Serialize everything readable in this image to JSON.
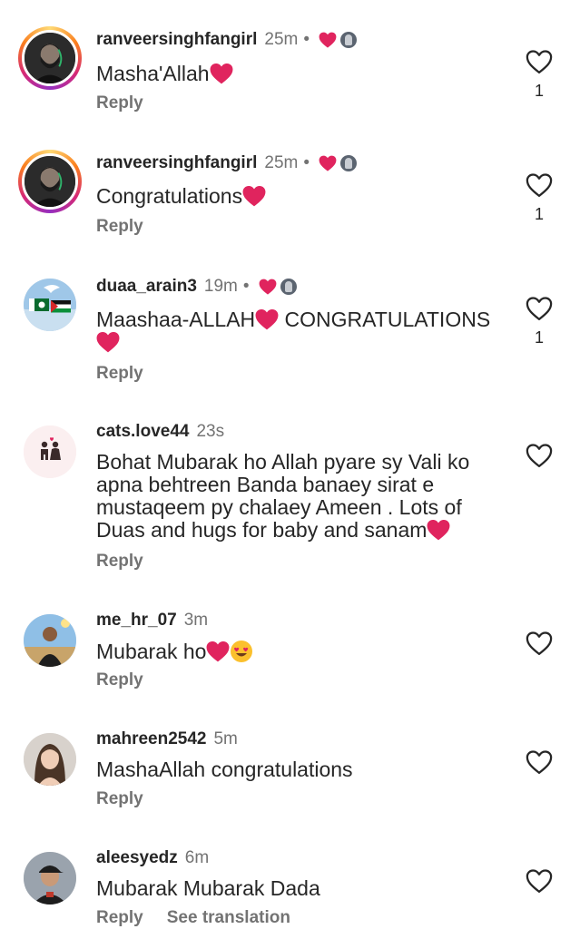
{
  "comments": [
    {
      "username": "ranveersinghfangirl",
      "time": "25m",
      "text": "Masha'Allah",
      "reply_label": "Reply",
      "like_count": "1",
      "avatar": "bearded-man-portrait",
      "liked_by_author": true
    },
    {
      "username": "ranveersinghfangirl",
      "time": "25m",
      "text": "Congratulations",
      "reply_label": "Reply",
      "like_count": "1",
      "avatar": "bearded-man-portrait",
      "liked_by_author": true
    },
    {
      "username": "duaa_arain3",
      "time": "19m",
      "text": "Maashaa-ALLAH",
      "text_after": " CONGRATULATIONS",
      "reply_label": "Reply",
      "like_count": "1",
      "avatar": "flags-sky",
      "liked_by_author": true
    },
    {
      "username": "cats.love44",
      "time": "23s",
      "text": "Bohat Mubarak ho Allah pyare sy Vali ko apna behtreen Banda banaey sirat e mustaqeem py chalaey Ameen . Lots of Duas and hugs for baby and sanam",
      "reply_label": "Reply",
      "avatar": "couple-silhouette"
    },
    {
      "username": "me_hr_07",
      "time": "3m",
      "text": "Mubarak ho",
      "reply_label": "Reply",
      "avatar": "man-outdoors"
    },
    {
      "username": "mahreen2542",
      "time": "5m",
      "text": "MashaAllah congratulations",
      "reply_label": "Reply",
      "avatar": "girl-portrait"
    },
    {
      "username": "aleesyedz",
      "time": "6m",
      "text": "Mubarak Mubarak Dada",
      "reply_label": "Reply",
      "see_translation_label": "See translation",
      "avatar": "man-cap"
    }
  ],
  "colors": {
    "text": "#262626",
    "muted": "#737373",
    "heart_red": "#e0245e"
  },
  "icons": {
    "like": "heart-outline-icon",
    "liked": "heart-filled-icon"
  }
}
